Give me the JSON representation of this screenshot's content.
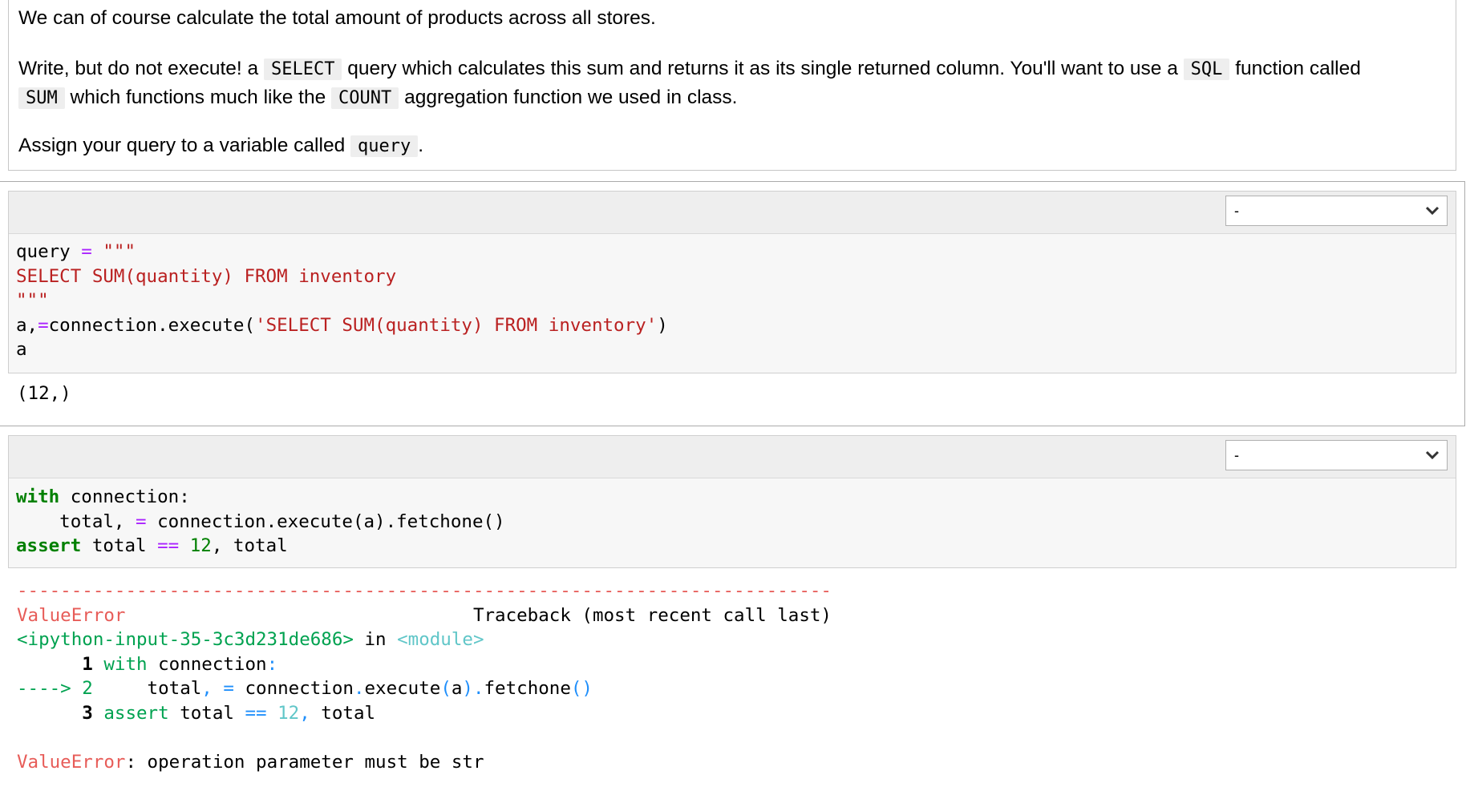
{
  "markdown": {
    "para1": "We can of course calculate the total amount of products across all stores.",
    "para2": {
      "t1": "Write, but do not execute! a ",
      "c1": "SELECT",
      "t2": " query which calculates this sum and returns it as its single returned column. You'll want to use a ",
      "c2": "SQL",
      "t3": " function called",
      "c3": "SUM",
      "t4": " which functions much like the ",
      "c4": "COUNT",
      "t5": " aggregation function we used in class."
    },
    "para3": {
      "t1": "Assign your query to a variable called ",
      "c1": "query",
      "t2": "."
    }
  },
  "cell1": {
    "tag_select_value": "-",
    "code": {
      "l1_var": "query",
      "l1_op": "=",
      "l1_str": "\"\"\"",
      "l2": "SELECT SUM(quantity) FROM inventory",
      "l3": "\"\"\"",
      "l4_a": "a,",
      "l4_op": "=",
      "l4_b": "connection.execute(",
      "l4_str": "'SELECT SUM(quantity) FROM inventory'",
      "l4_c": ")",
      "l5": "a"
    },
    "output": "(12,)"
  },
  "cell2": {
    "tag_select_value": "-",
    "code": {
      "l1_kw": "with",
      "l1_rest": " connection:",
      "l2_a": "    total, ",
      "l2_op": "=",
      "l2_b": " connection.execute(a).fetchone()",
      "l3_kw": "assert",
      "l3_a": " total ",
      "l3_op": "==",
      "l3_num": "12",
      "l3_b": ", total"
    },
    "traceback": {
      "dashes": "---------------------------------------------------------------------------",
      "error_name": "ValueError",
      "traceback_header": "Traceback (most recent call last)",
      "input_ref": "<ipython-input-35-3c3d231de686>",
      "in_word": " in ",
      "module": "<module>",
      "f1_num": "      1",
      "f1_kw": "with",
      "f1_rest": " connection",
      "f1_colon": ":",
      "f2_arrow": "----> 2",
      "f2_a": "     total",
      "f2_comma": ",",
      "f2_eq": "=",
      "f2_b": " connection",
      "f2_dot": ".",
      "f2_c": "execute",
      "f2_p1": "(",
      "f2_d": "a",
      "f2_p2": ")",
      "f2_dot2": ".",
      "f2_e": "fetchone",
      "f2_p3": "()",
      "f3_num": "      3",
      "f3_kw": "assert",
      "f3_a": " total ",
      "f3_op": "==",
      "f3_num_val": "12",
      "f3_comma": ",",
      "f3_b": " total",
      "final_name": "ValueError",
      "final_msg": ": operation parameter must be str"
    }
  },
  "colors": {
    "keyword": "#008000",
    "string": "#ba2121",
    "operator": "#aa22ff",
    "error_red": "#e75c58",
    "traceback_green": "#00a250",
    "traceback_blue": "#208ffb"
  }
}
